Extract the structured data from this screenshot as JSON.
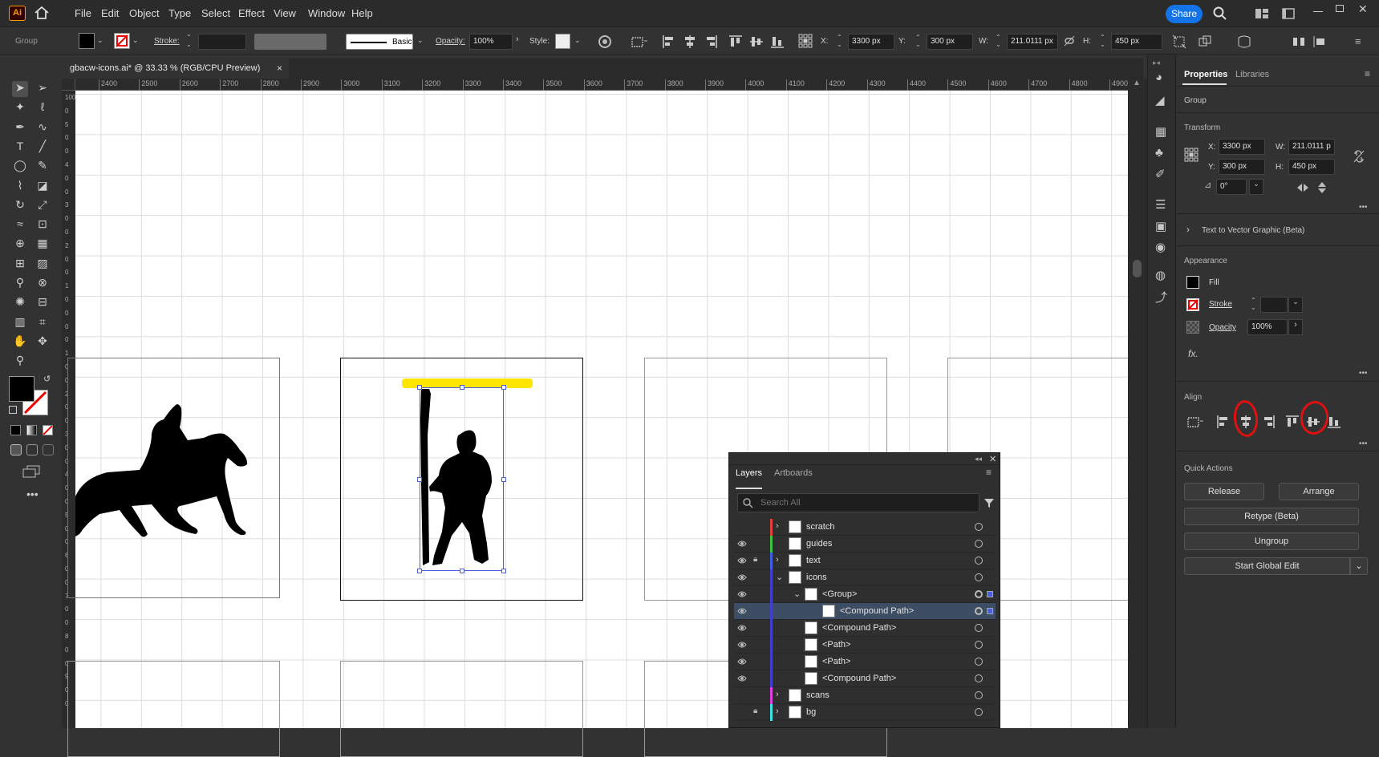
{
  "app": {
    "logo_text": "Ai",
    "share_label": "Share"
  },
  "menu": [
    "File",
    "Edit",
    "Object",
    "Type",
    "Select",
    "Effect",
    "View",
    "Window",
    "Help"
  ],
  "control": {
    "selection_label": "Group",
    "stroke_label": "Stroke:",
    "brush_label": "Basic",
    "opacity_label": "Opacity:",
    "opacity_value": "100%",
    "style_label": "Style:",
    "x_label": "X:",
    "x_value": "3300 px",
    "y_label": "Y:",
    "y_value": "300 px",
    "w_label": "W:",
    "w_value": "211.0111 px",
    "h_label": "H:",
    "h_value": "450 px"
  },
  "document": {
    "tab_title": "gbacw-icons.ai* @ 33.33 % (RGB/CPU Preview)",
    "close": "×"
  },
  "ruler": {
    "h_ticks": [
      "2400",
      "2500",
      "2600",
      "2700",
      "2800",
      "2900",
      "3000",
      "3100",
      "3200",
      "3300",
      "3400",
      "3500",
      "3600",
      "3700",
      "3800",
      "3900",
      "4000",
      "4100",
      "4200",
      "4300",
      "4400",
      "4500",
      "4600",
      "4700",
      "4800",
      "4900"
    ],
    "v_ticks": [
      "100",
      "0",
      "5",
      "0",
      "0",
      "4",
      "0",
      "0",
      "3",
      "0",
      "0",
      "2",
      "0",
      "0",
      "1",
      "0",
      "0",
      "0",
      "0",
      "1",
      "0",
      "0",
      "2",
      "0",
      "0",
      "3",
      "0",
      "0",
      "4",
      "0",
      "0",
      "5",
      "0",
      "0",
      "6",
      "0",
      "0",
      "7",
      "0",
      "0",
      "8",
      "0",
      "0",
      "9",
      "0",
      "0"
    ]
  },
  "properties": {
    "tabs": [
      "Properties",
      "Libraries"
    ],
    "selection": "Group",
    "transform_title": "Transform",
    "x_label": "X:",
    "x_value": "3300 px",
    "y_label": "Y:",
    "y_value": "300 px",
    "w_label": "W:",
    "w_value": "211.0111 p",
    "h_label": "H:",
    "h_value": "450 px",
    "angle_value": "0°",
    "text_to_vector": "Text to Vector Graphic (Beta)",
    "appearance_title": "Appearance",
    "fill_label": "Fill",
    "stroke_label": "Stroke",
    "opacity_label": "Opacity",
    "opacity_value": "100%",
    "fx_label": "fx.",
    "align_title": "Align",
    "quick_actions_title": "Quick Actions",
    "release": "Release",
    "arrange": "Arrange",
    "retype": "Retype (Beta)",
    "ungroup": "Ungroup",
    "global_edit": "Start Global Edit"
  },
  "layers_panel": {
    "tabs": [
      "Layers",
      "Artboards"
    ],
    "search_placeholder": "Search All",
    "rows": [
      {
        "name": "scratch",
        "color": "#e04040",
        "visible": false,
        "locked": false,
        "expandable": true,
        "indent": 0
      },
      {
        "name": "guides",
        "color": "#40c040",
        "visible": true,
        "locked": false,
        "expandable": false,
        "indent": 0
      },
      {
        "name": "text",
        "color": "#4060e0",
        "visible": true,
        "locked": true,
        "expandable": true,
        "indent": 0
      },
      {
        "name": "icons",
        "color": "#4040d0",
        "visible": true,
        "locked": false,
        "expandable": true,
        "expanded": true,
        "indent": 0
      },
      {
        "name": "<Group>",
        "color": "#4040d0",
        "visible": true,
        "locked": false,
        "expandable": true,
        "expanded": true,
        "indent": 1
      },
      {
        "name": "<Compound Path>",
        "color": "#4040d0",
        "visible": true,
        "locked": false,
        "expandable": false,
        "indent": 2,
        "selected": true
      },
      {
        "name": "<Compound Path>",
        "color": "#4040d0",
        "visible": true,
        "locked": false,
        "expandable": false,
        "indent": 1
      },
      {
        "name": "<Path>",
        "color": "#4040d0",
        "visible": true,
        "locked": false,
        "expandable": false,
        "indent": 1
      },
      {
        "name": "<Path>",
        "color": "#4040d0",
        "visible": true,
        "locked": false,
        "expandable": false,
        "indent": 1
      },
      {
        "name": "<Compound Path>",
        "color": "#4040d0",
        "visible": true,
        "locked": false,
        "expandable": false,
        "indent": 1
      },
      {
        "name": "scans",
        "color": "#e040e0",
        "visible": false,
        "locked": false,
        "expandable": true,
        "indent": 0
      },
      {
        "name": "bg",
        "color": "#40e0e0",
        "visible": false,
        "locked": true,
        "expandable": true,
        "indent": 0
      }
    ]
  },
  "colors": {
    "accent": "#1473e6",
    "logo_bg": "#330000",
    "logo_fg": "#ff9a00",
    "highlight": "#ffe600",
    "annotation": "#e01010"
  }
}
